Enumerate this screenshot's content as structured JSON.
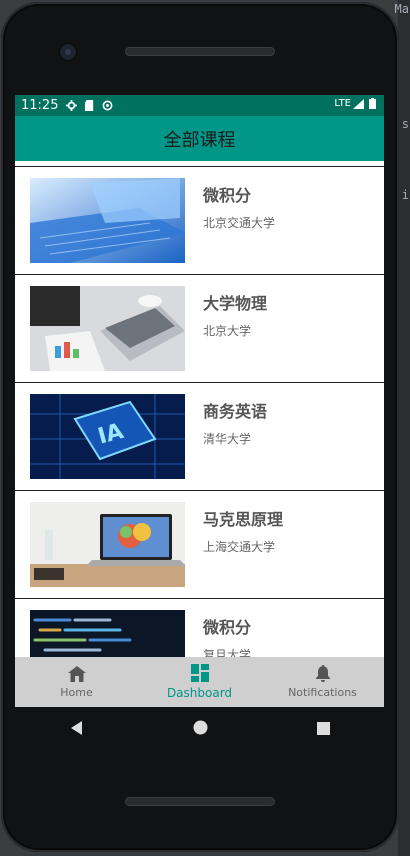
{
  "status": {
    "time": "11:25",
    "network": "LTE"
  },
  "appbar": {
    "title": "全部课程"
  },
  "courses": [
    {
      "title": "微积分",
      "school": "北京交通大学",
      "image": "laptop-blue-image"
    },
    {
      "title": "大学物理",
      "school": "北京大学",
      "image": "meeting-laptop-image"
    },
    {
      "title": "商务英语",
      "school": "清华大学",
      "image": "ai-chip-image"
    },
    {
      "title": "马克思原理",
      "school": "上海交通大学",
      "image": "desk-laptop-image"
    },
    {
      "title": "微积分",
      "school": "复旦大学",
      "image": "code-screen-image"
    }
  ],
  "bottom_nav": [
    {
      "label": "Home",
      "icon": "home-icon",
      "active": false
    },
    {
      "label": "Dashboard",
      "icon": "dashboard-icon",
      "active": true
    },
    {
      "label": "Notifications",
      "icon": "bell-icon",
      "active": false
    }
  ],
  "colors": {
    "primary": "#009688",
    "status_bar": "#00705f",
    "nav_bg": "#cfcfcf"
  }
}
